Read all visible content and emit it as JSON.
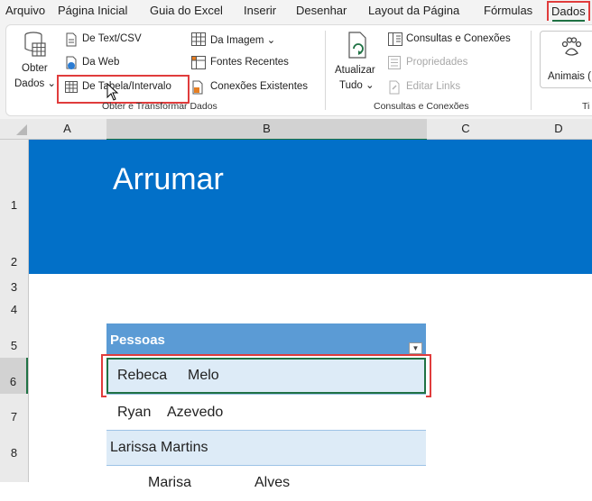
{
  "menu": {
    "tabs": [
      "Arquivo",
      "Página Inicial",
      "Guia do Excel",
      "Inserir",
      "Desenhar",
      "Layout da Página",
      "Fórmulas"
    ],
    "active_tab": "Dados"
  },
  "ribbon": {
    "get_data": {
      "line1": "Obter",
      "line2": "Dados ⌄"
    },
    "from_text_csv": "De Text/CSV",
    "from_web": "Da Web",
    "from_table_range": "De Tabela/Intervalo",
    "from_image": "Da Imagem ⌄",
    "recent_sources": "Fontes Recentes",
    "existing_connections": "Conexões Existentes",
    "group_get_transform": "Obter e Transformar Dados",
    "refresh_all": {
      "line1": "Atualizar",
      "line2": "Tudo ⌄"
    },
    "queries_connections": "Consultas e Conexões",
    "properties": "Propriedades",
    "edit_links": "Editar Links",
    "group_queries": "Consultas e Conexões",
    "animals": "Animais (",
    "group_types": "Ti"
  },
  "columns": [
    "A",
    "B",
    "C",
    "D"
  ],
  "rows": [
    "1",
    "2",
    "3",
    "4",
    "5",
    "6",
    "7",
    "8"
  ],
  "banner": {
    "title": "Arrumar"
  },
  "table": {
    "header": "Pessoas",
    "rows": [
      {
        "first": "Rebeca",
        "last": "Melo"
      },
      {
        "first": "Ryan",
        "last": "Azevedo"
      },
      {
        "first": "Larissa Martins",
        "last": ""
      },
      {
        "first": "Marisa",
        "last": "Alves"
      }
    ]
  },
  "colors": {
    "accent": "#1f7244",
    "highlight": "#e03c3c",
    "banner": "#0270c8",
    "table_header": "#5b9bd5",
    "table_band": "#ddebf7"
  }
}
